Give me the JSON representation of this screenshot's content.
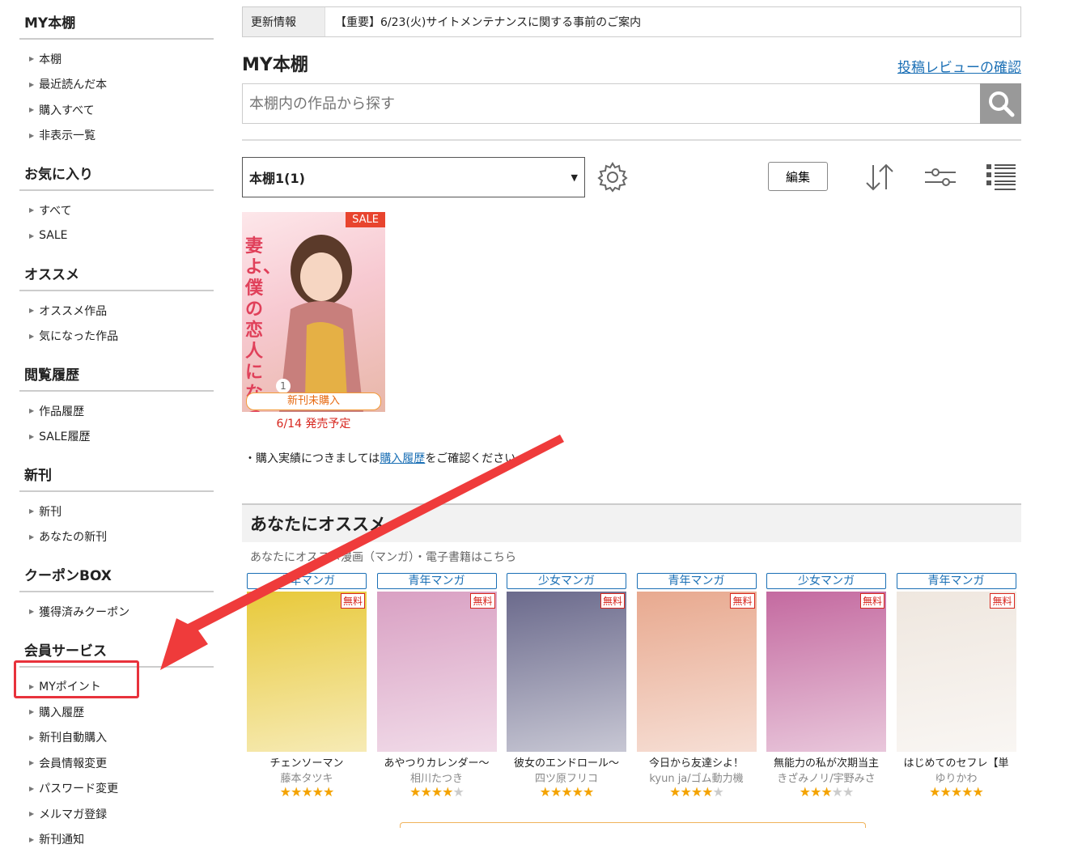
{
  "sidebar": {
    "sections": [
      {
        "title": "MY本棚",
        "items": [
          "本棚",
          "最近読んだ本",
          "購入すべて",
          "非表示一覧"
        ]
      },
      {
        "title": "お気に入り",
        "items": [
          "すべて",
          "SALE"
        ]
      },
      {
        "title": "オススメ",
        "items": [
          "オススメ作品",
          "気になった作品"
        ]
      },
      {
        "title": "閲覧履歴",
        "items": [
          "作品履歴",
          "SALE履歴"
        ]
      },
      {
        "title": "新刊",
        "items": [
          "新刊",
          "あなたの新刊"
        ]
      },
      {
        "title": "クーポンBOX",
        "items": [
          "獲得済みクーポン"
        ]
      },
      {
        "title": "会員サービス",
        "items": [
          "MYポイント",
          "購入履歴",
          "新刊自動購入",
          "会員情報変更",
          "パスワード変更",
          "メルマガ登録",
          "新刊通知"
        ]
      }
    ]
  },
  "notice": {
    "label": "更新情報",
    "text": "【重要】6/23(火)サイトメンテナンスに関する事前のご案内"
  },
  "header": {
    "title": "MY本棚",
    "review_link": "投稿レビューの確認"
  },
  "search": {
    "placeholder": "本棚内の作品から探す"
  },
  "shelf": {
    "selected": "本棚1(1)",
    "edit_label": "編集"
  },
  "book": {
    "sale_badge": "SALE",
    "unpurchased_badge": "新刊未購入",
    "release": "6/14 発売予定",
    "cover_text": "妻よ、僕の恋人になってくれませんか",
    "volume": "1"
  },
  "note": {
    "prefix": "・購入実績につきましては",
    "link": "購入履歴",
    "suffix": "をご確認ください"
  },
  "recommend": {
    "heading": "あなたにオススメ",
    "subtitle": "あなたにオススメ漫画（マンガ）・電子書籍はこちら",
    "free_label": "無料",
    "cards": [
      {
        "genre": "少年マンガ",
        "title": "チェンソーマン",
        "author": "藤本タツキ",
        "rating": 4.5,
        "color": "#e8c93a"
      },
      {
        "genre": "青年マンガ",
        "title": "あやつりカレンダー～",
        "author": "相川たつき",
        "rating": 4.0,
        "color": "#d9a0c3"
      },
      {
        "genre": "少女マンガ",
        "title": "彼女のエンドロール～",
        "author": "四ツ原フリコ",
        "rating": 4.5,
        "color": "#6b6a8c"
      },
      {
        "genre": "青年マンガ",
        "title": "今日から友達シよ！",
        "author": "kyun ja/ゴム動力機",
        "rating": 4.0,
        "color": "#e8a98f"
      },
      {
        "genre": "少女マンガ",
        "title": "無能力の私が次期当主",
        "author": "きざみノリ/宇野みさ",
        "rating": 3.0,
        "color": "#c46aa0"
      },
      {
        "genre": "青年マンガ",
        "title": "はじめてのセフレ【単",
        "author": "ゆりかわ",
        "rating": 4.5,
        "color": "#efe7df"
      }
    ]
  },
  "colors": {
    "accent_link": "#1a6fb5",
    "highlight": "#e8323c",
    "sale": "#e8442e"
  }
}
